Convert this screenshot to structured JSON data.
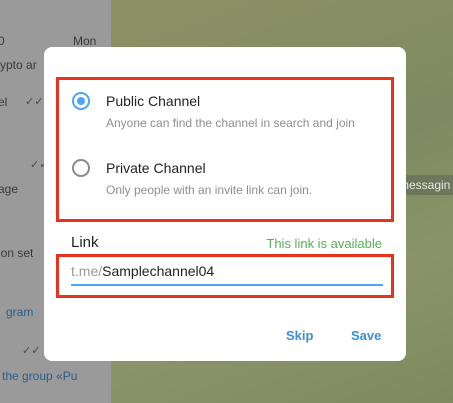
{
  "background": {
    "chat_list": [
      {
        "text": "Mon",
        "style": "normal"
      },
      {
        "text": "ypto ar",
        "style": "normal"
      },
      {
        "text": "el",
        "style": "normal"
      },
      {
        "text": "age",
        "style": "normal"
      },
      {
        "text": "ion set",
        "style": "normal"
      },
      {
        "text": "gram",
        "style": "blue"
      },
      {
        "text": "the group «Pu",
        "style": "blue"
      },
      {
        "text": "0",
        "style": "normal"
      }
    ],
    "bubble_text": "messagin"
  },
  "dialog": {
    "options": [
      {
        "title": "Public Channel",
        "subtitle": "Anyone can find the channel in search and join",
        "selected": true
      },
      {
        "title": "Private Channel",
        "subtitle": "Only people with an invite link can join.",
        "selected": false
      }
    ],
    "link": {
      "label": "Link",
      "status": "This link is available",
      "prefix": "t.me/",
      "value": "Samplechannel04"
    },
    "buttons": {
      "skip": "Skip",
      "save": "Save"
    }
  },
  "colors": {
    "accent": "#4ea4f6",
    "available": "#56b050",
    "highlight": "#e8321b"
  }
}
